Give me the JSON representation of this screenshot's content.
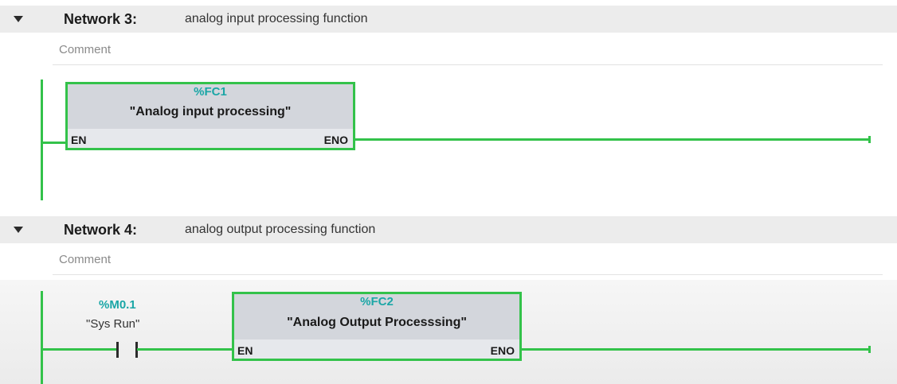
{
  "networks": [
    {
      "title": "Network 3:",
      "description": "analog input processing function",
      "comment_placeholder": "Comment",
      "block": {
        "id": "%FC1",
        "name": "\"Analog input processing\"",
        "en": "EN",
        "eno": "ENO"
      }
    },
    {
      "title": "Network 4:",
      "description": "analog output processing function",
      "comment_placeholder": "Comment",
      "contact": {
        "address": "%M0.1",
        "tag": "\"Sys Run\""
      },
      "block": {
        "id": "%FC2",
        "name": "\"Analog Output Processsing\"",
        "en": "EN",
        "eno": "ENO"
      }
    }
  ],
  "colors": {
    "wire": "#33c24a",
    "address": "#1aa6a6",
    "header_bg": "#ececec",
    "box_bg": "#d9dbe0"
  },
  "icons": {
    "collapse": "triangle-down-icon"
  }
}
